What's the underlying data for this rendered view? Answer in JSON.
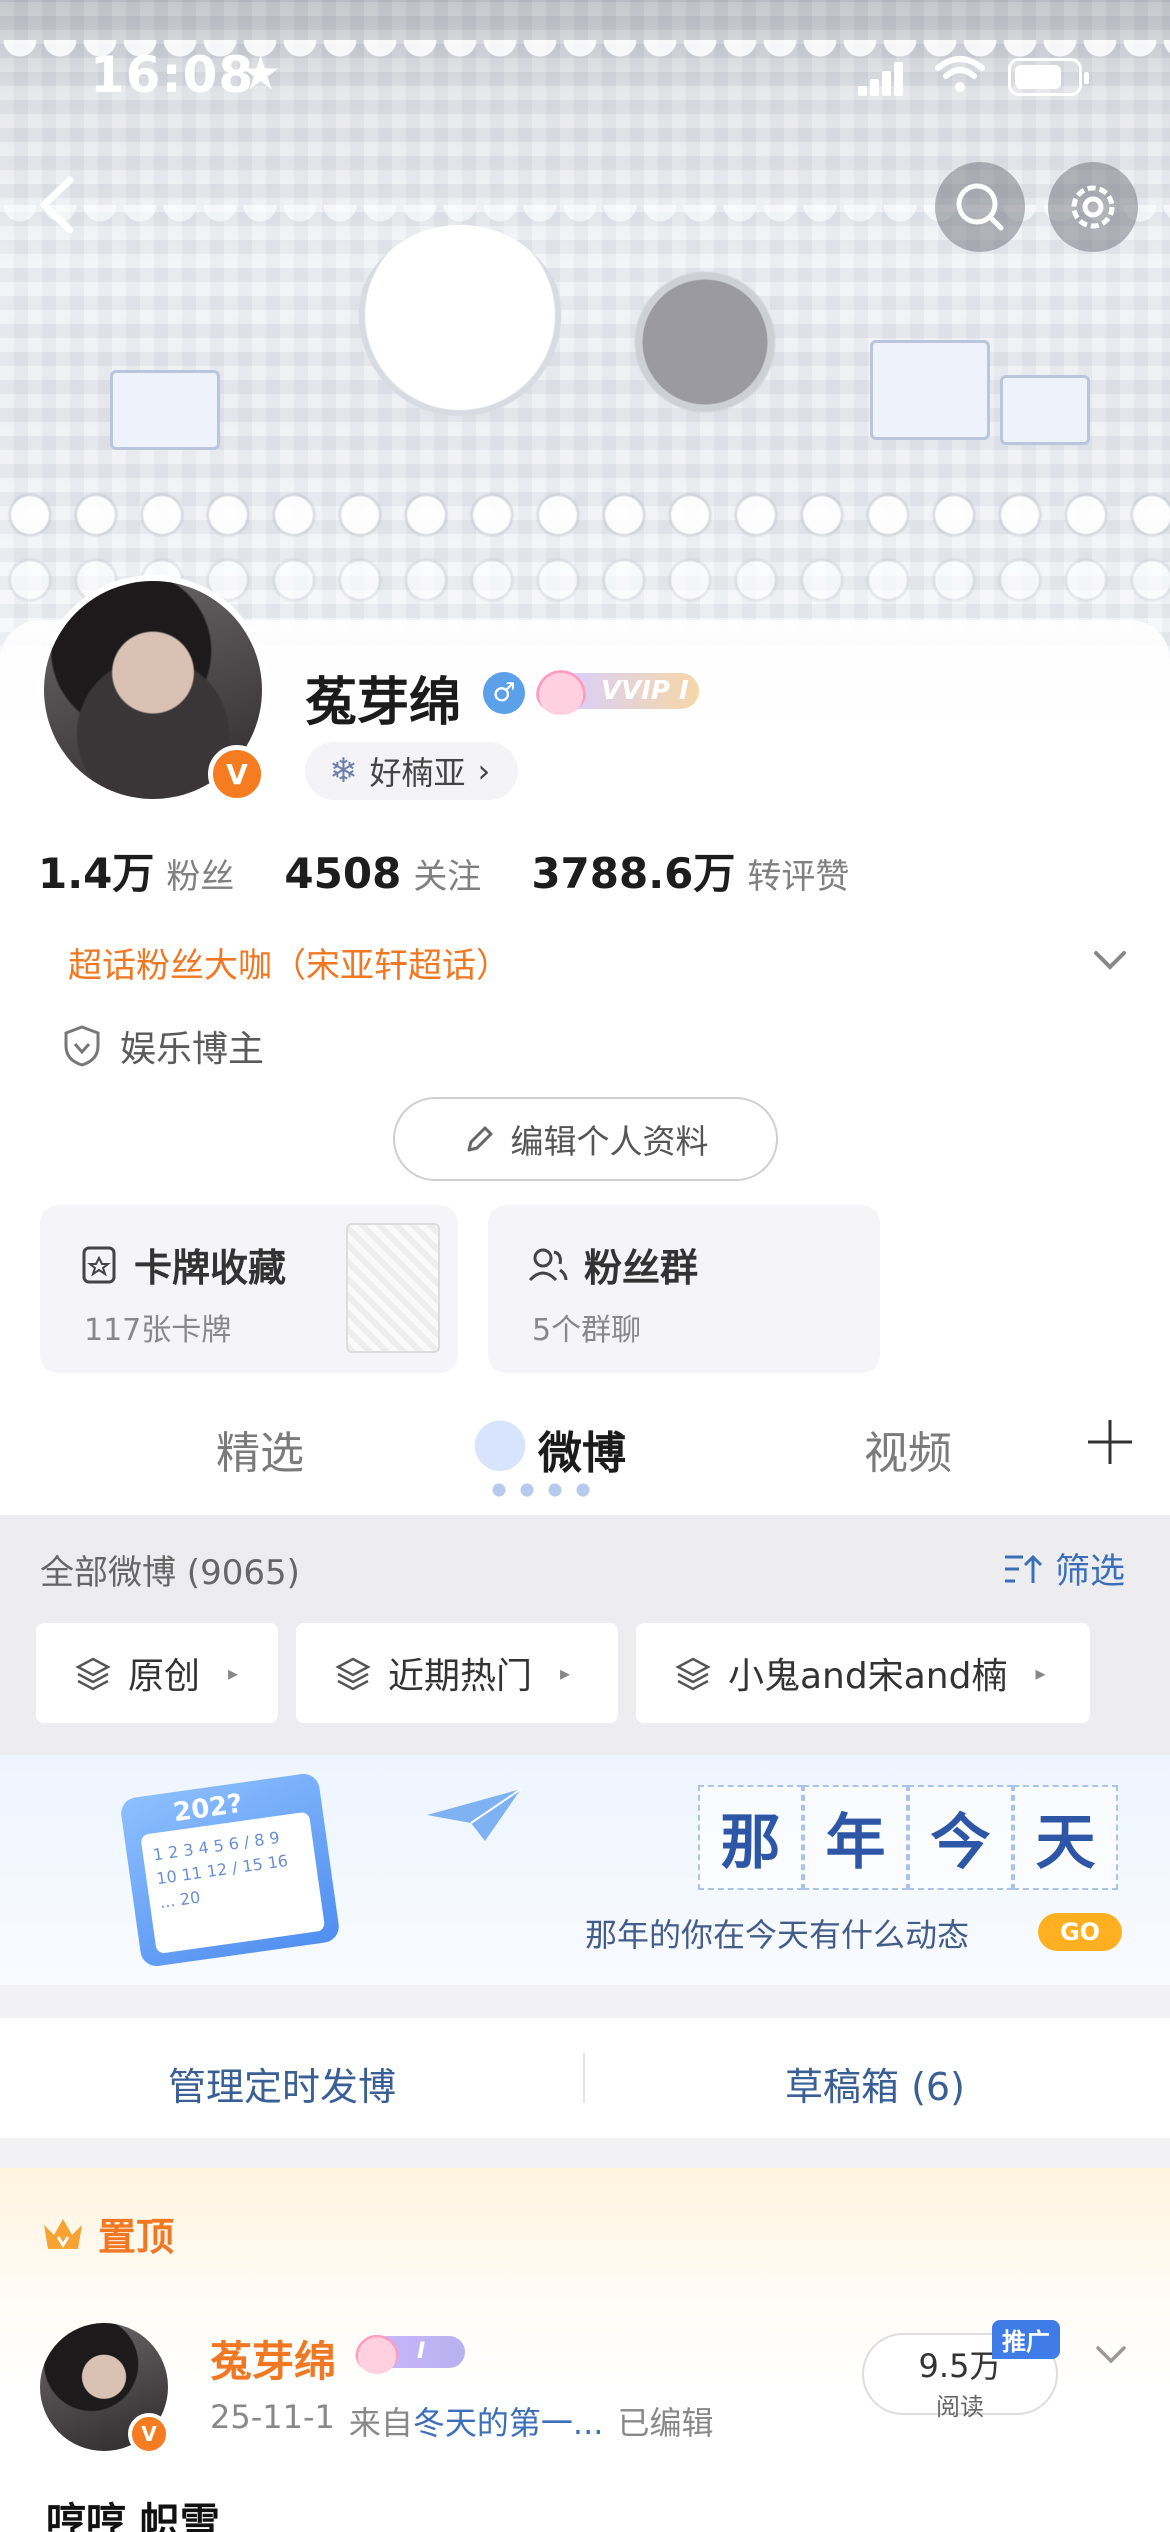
{
  "status_bar": {
    "time": "16:08",
    "star": "★"
  },
  "profile": {
    "name": "菟芽绵",
    "gender_symbol": "♂",
    "vip_label": "VVIP I",
    "verified_symbol": "V",
    "nickname": "好楠亚",
    "nickname_icon": "❄",
    "stats": [
      {
        "num": "1.4万",
        "label": "粉丝"
      },
      {
        "num": "4508",
        "label": "关注"
      },
      {
        "num": "3788.6万",
        "label": "转评赞"
      }
    ],
    "fan_title": "超话粉丝大咖（宋亚轩超话）",
    "role": "娱乐博主",
    "edit_button": "编辑个人资料"
  },
  "cards": {
    "collection": {
      "title": "卡牌收藏",
      "sub": "117张卡牌"
    },
    "group": {
      "title": "粉丝群",
      "sub": "5个群聊"
    }
  },
  "tabs": [
    {
      "label": "精选",
      "active": false
    },
    {
      "label": "微博",
      "active": true
    },
    {
      "label": "视频",
      "active": false
    }
  ],
  "feed": {
    "all_label": "全部微博 (9065)",
    "filter_label": "筛选",
    "chips": [
      "原创",
      "近期热门",
      "小鬼and宋and楠"
    ]
  },
  "throwback": {
    "title_chars": [
      "那",
      "年",
      "今",
      "天"
    ],
    "subtitle": "那年的你在今天有什么动态",
    "go": "GO",
    "calendar_year": "202?",
    "calendar_numbers": "1 2 3 4 5 6 / 8 9 10 11 12 / 15 16 ... 20"
  },
  "manage": {
    "scheduled": "管理定时发博",
    "drafts": "草稿箱 (6)"
  },
  "pinned": {
    "label": "置顶",
    "author": "菟芽绵",
    "vip_label": "I",
    "date": "25-11-1",
    "source_prefix": "来自",
    "source": "冬天的第一...",
    "edited": "已编辑",
    "reads_num": "9.5万",
    "reads_label": "阅读",
    "promo": "推广",
    "text_start": "哼哼 帜雪"
  },
  "colors": {
    "accent_orange": "#f07822",
    "link_blue": "#3b6fba",
    "verified_orange": "#f57c20"
  }
}
